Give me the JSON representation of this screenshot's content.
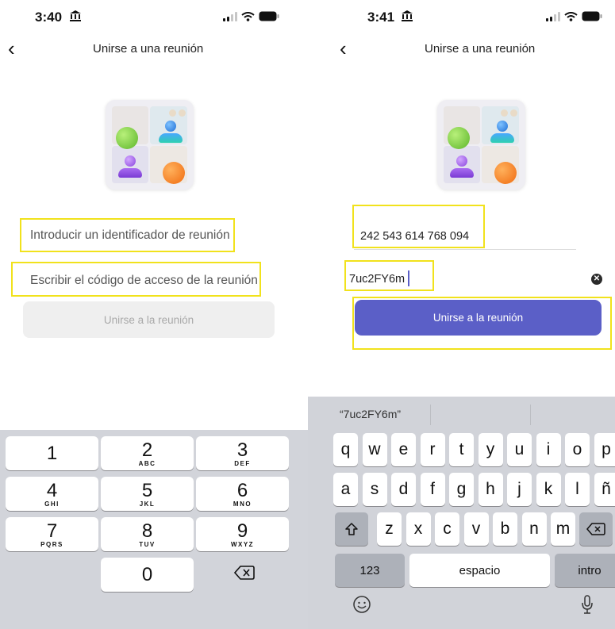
{
  "colors": {
    "accent": "#5b5fc7",
    "highlight": "#f1e21c",
    "keyboard_bg": "#d2d4da"
  },
  "left": {
    "time": "3:40",
    "nav_title": "Unirse a una reunión",
    "meeting_id_placeholder": "Introducir un identificador de reunión",
    "passcode_placeholder": "Escribir el código de acceso de la reunión",
    "join_button": "Unirse a la reunión",
    "keypad": [
      {
        "digit": "1",
        "letters": ""
      },
      {
        "digit": "2",
        "letters": "ABC"
      },
      {
        "digit": "3",
        "letters": "DEF"
      },
      {
        "digit": "4",
        "letters": "GHI"
      },
      {
        "digit": "5",
        "letters": "JKL"
      },
      {
        "digit": "6",
        "letters": "MNO"
      },
      {
        "digit": "7",
        "letters": "PQRS"
      },
      {
        "digit": "8",
        "letters": "TUV"
      },
      {
        "digit": "9",
        "letters": "WXYZ"
      },
      {
        "digit": "0",
        "letters": ""
      }
    ]
  },
  "right": {
    "time": "3:41",
    "nav_title": "Unirse a una reunión",
    "meeting_id_value": "242 543 614 768 094",
    "passcode_value": "7uc2FY6m",
    "join_button": "Unirse a la reunión",
    "suggestion": "“7uc2FY6m”",
    "row1": [
      "q",
      "w",
      "e",
      "r",
      "t",
      "y",
      "u",
      "i",
      "o",
      "p"
    ],
    "row2": [
      "a",
      "s",
      "d",
      "f",
      "g",
      "h",
      "j",
      "k",
      "l",
      "ñ"
    ],
    "row3": [
      "z",
      "x",
      "c",
      "v",
      "b",
      "n",
      "m"
    ],
    "numbers_key": "123",
    "space_key": "espacio",
    "return_key": "intro"
  }
}
